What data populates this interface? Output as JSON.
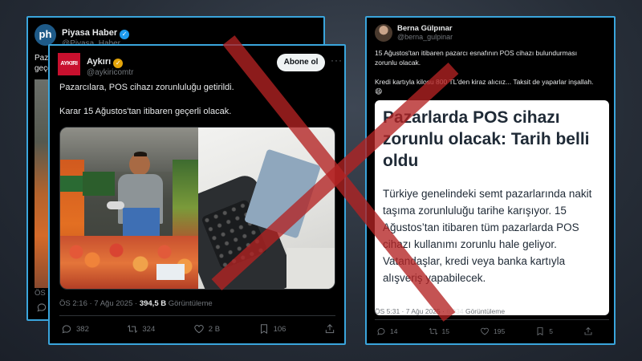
{
  "colors": {
    "frame": "#3aa5dc",
    "cross": "#b32222",
    "verified_blue": "#1d9bf0",
    "verified_gold": "#e5a50a"
  },
  "tweet_back": {
    "avatar_text": "ph",
    "name": "Piyasa Haber",
    "handle": "@Piyasa_Haber",
    "text_fragment_1": "Pazar",
    "text_fragment_2": "geçe",
    "time_fragment": "ÖS 2"
  },
  "tweet_main": {
    "avatar_text": "AYKIRI",
    "name": "Aykırı",
    "handle": "@aykiricomtr",
    "follow_label": "Abone ol",
    "more_icon": "more-icon",
    "line1": "Pazarcılara, POS cihazı zorunluluğu getirildi.",
    "line2": "Karar 15 Ağustos'tan itibaren geçerli olacak.",
    "meta_time": "ÖS 2:16 · 7 Ağu 2025 · ",
    "meta_views": "394,5 B",
    "meta_views_label": " Görüntüleme",
    "replies": "382",
    "reposts": "324",
    "likes": "2 B",
    "bookmarks": "106"
  },
  "tweet_right": {
    "name": "Berna Gülpınar",
    "handle": "@berna_gulpinar",
    "line1": "15 Ağustos'tan itibaren pazarcı esnafının POS cihazı bulundurması",
    "line2": "zorunlu olacak.",
    "line3": "Kredi kartıyla kilosu 800 TL'den kiraz alıcıız... Taksit de yaparlar inşallah.",
    "emoji": "😄",
    "headline": "Pazarlarda POS cihazı zorunlu olacak: Tarih belli oldu",
    "body": "Türkiye genelindeki semt pazarlarında nakit taşıma zorunluluğu tarihe karışıyor. 15 Ağustos’tan itibaren tüm pazarlarda POS cihazı kullanımı zorunlu hale geliyor. Vatandaşlar, kredi veya banka kartıyla alışveriş yapabilecek.",
    "meta_time": "ÖS 5:31 · 7 Ağu 2025 · ",
    "meta_views": "6.034",
    "meta_views_label": " Görüntüleme",
    "replies": "14",
    "reposts": "15",
    "likes": "195",
    "bookmarks": "5"
  }
}
